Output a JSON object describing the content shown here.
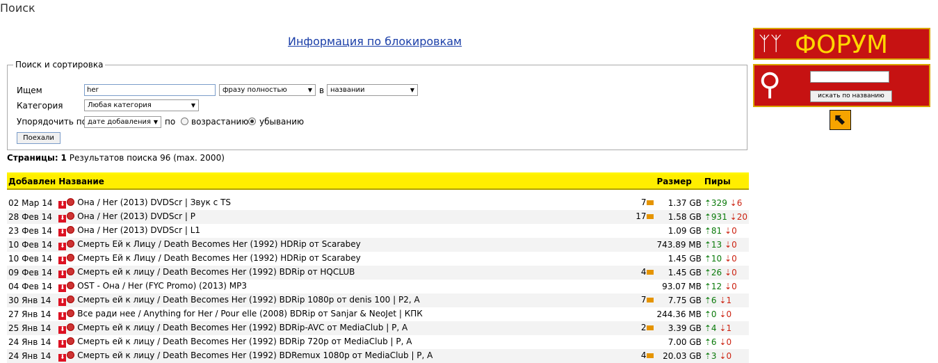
{
  "page_title": "Поиск",
  "info_link": "Информация по блокировкам",
  "search": {
    "legend": "Поиск и сортировка",
    "query_label": "Ищем",
    "query_value": "her",
    "match_select": "фразу полностью",
    "in_label": "в",
    "field_select": "названии",
    "category_label": "Категория",
    "category_select": "Любая категория",
    "order_label": "Упорядочить по",
    "order_select": "дате добавления",
    "by_label": "по",
    "asc_label": "возрастанию",
    "desc_label": "убыванию",
    "submit": "Поехали"
  },
  "pages": {
    "label": "Страницы:",
    "current": "1",
    "results": "Результатов поиска 96 (max. 2000)"
  },
  "table": {
    "headers": {
      "date": "Добавлен",
      "name": "Название",
      "size": "Размер",
      "peers": "Пиры"
    },
    "rows": [
      {
        "date": "02 Мар 14",
        "name": "Она / Her (2013) DVDScr | Звук с TS",
        "comments": "7",
        "size": "1.37 GB",
        "seeds": "329",
        "leech": "6"
      },
      {
        "date": "28 Фев 14",
        "name": "Она / Her (2013) DVDScr | P",
        "comments": "17",
        "size": "1.58 GB",
        "seeds": "931",
        "leech": "20"
      },
      {
        "date": "23 Фев 14",
        "name": "Она / Her (2013) DVDScr | L1",
        "comments": "",
        "size": "1.09 GB",
        "seeds": "81",
        "leech": "0"
      },
      {
        "date": "10 Фев 14",
        "name": "Смерть Ей к Лицу / Death Becomes Her (1992) HDRip от Scarabey",
        "comments": "",
        "size": "743.89 MB",
        "seeds": "13",
        "leech": "0"
      },
      {
        "date": "10 Фев 14",
        "name": "Смерть Ей к Лицу / Death Becomes Her (1992) HDRip от Scarabey",
        "comments": "",
        "size": "1.45 GB",
        "seeds": "10",
        "leech": "0"
      },
      {
        "date": "09 Фев 14",
        "name": "Смерть ей к лицу / Death Becomes Her (1992) BDRip от HQCLUB",
        "comments": "4",
        "size": "1.45 GB",
        "seeds": "26",
        "leech": "0"
      },
      {
        "date": "04 Фев 14",
        "name": "OST - Она / Her (FYC Promo) (2013) MP3",
        "comments": "",
        "size": "93.07 MB",
        "seeds": "12",
        "leech": "0"
      },
      {
        "date": "30 Янв 14",
        "name": "Смерть ей к лицу / Death Becomes Her (1992) BDRip 1080p от denis 100 | P2, A",
        "comments": "7",
        "size": "7.75 GB",
        "seeds": "6",
        "leech": "1"
      },
      {
        "date": "27 Янв 14",
        "name": "Все ради нее / Anything for Her / Pour elle (2008) BDRip от Sanjar & NeoJet | КПК",
        "comments": "",
        "size": "244.36 MB",
        "seeds": "0",
        "leech": "0"
      },
      {
        "date": "25 Янв 14",
        "name": "Смерть ей к лицу / Death Becomes Her (1992) BDRip-AVC от MediaClub | P, A",
        "comments": "2",
        "size": "3.39 GB",
        "seeds": "4",
        "leech": "1"
      },
      {
        "date": "24 Янв 14",
        "name": "Смерть ей к лицу / Death Becomes Her (1992) BDRip 720p от MediaClub | P, A",
        "comments": "",
        "size": "7.00 GB",
        "seeds": "6",
        "leech": "0"
      },
      {
        "date": "24 Янв 14",
        "name": "Смерть ей к лицу / Death Becomes Her (1992) BDRemux 1080p от MediaClub | P, A",
        "comments": "4",
        "size": "20.03 GB",
        "seeds": "3",
        "leech": "0"
      }
    ]
  },
  "sidebar": {
    "forum_text": "ФОРУМ",
    "search_button": "искать по названию"
  },
  "colors": {
    "header_bg": "#ffee00",
    "banner_bg": "#c61212",
    "link": "#1a3ea8",
    "seed": "#0a7a0a",
    "leech": "#c21"
  }
}
